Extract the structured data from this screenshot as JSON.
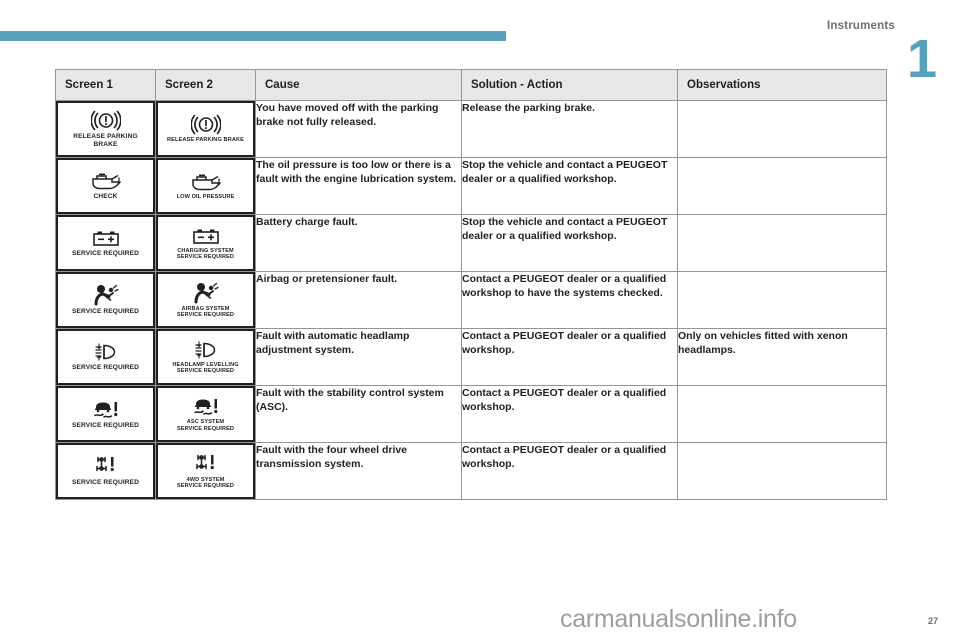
{
  "header": {
    "title": "Instruments",
    "chapter_number": "1",
    "band_color": "#57a0bc"
  },
  "table": {
    "columns": [
      "Screen 1",
      "Screen 2",
      "Cause",
      "Solution - Action",
      "Observations"
    ],
    "rows": [
      {
        "screen1": {
          "icon": "parking-brake-icon",
          "label": "RELEASE PARKING\nBRAKE"
        },
        "screen2": {
          "icon": "parking-brake-icon",
          "label": "RELEASE PARKING BRAKE"
        },
        "cause": "You have moved off with the parking brake not fully released.",
        "solution": "Release the parking brake.",
        "observations": ""
      },
      {
        "screen1": {
          "icon": "oil-can-icon",
          "label": "CHECK"
        },
        "screen2": {
          "icon": "oil-can-icon",
          "label": "LOW OIL PRESSURE"
        },
        "cause": "The oil pressure is too low or there is a fault with the engine lubrication system.",
        "solution": "Stop the vehicle and contact a PEUGEOT dealer or a qualified workshop.",
        "observations": ""
      },
      {
        "screen1": {
          "icon": "battery-icon",
          "label": "SERVICE REQUIRED"
        },
        "screen2": {
          "icon": "battery-icon",
          "label": "CHARGING SYSTEM\nSERVICE REQUIRED"
        },
        "cause": "Battery charge fault.",
        "solution": "Stop the vehicle and contact a PEUGEOT dealer or a qualified workshop.",
        "observations": ""
      },
      {
        "screen1": {
          "icon": "airbag-icon",
          "label": "SERVICE REQUIRED"
        },
        "screen2": {
          "icon": "airbag-icon",
          "label": "AIRBAG SYSTEM\nSERVICE REQUIRED"
        },
        "cause": "Airbag or pretensioner fault.",
        "solution": "Contact a PEUGEOT dealer or a qualified workshop to have the systems checked.",
        "observations": ""
      },
      {
        "screen1": {
          "icon": "headlamp-levelling-icon",
          "label": "SERVICE REQUIRED"
        },
        "screen2": {
          "icon": "headlamp-levelling-icon",
          "label": "HEADLAMP LEVELLING\nSERVICE REQUIRED"
        },
        "cause": "Fault with automatic headlamp adjustment system.",
        "solution": "Contact a PEUGEOT dealer or a qualified workshop.",
        "observations": "Only on vehicles fitted with xenon headlamps."
      },
      {
        "screen1": {
          "icon": "stability-control-icon",
          "label": "SERVICE REQUIRED"
        },
        "screen2": {
          "icon": "stability-control-icon",
          "label": "ASC SYSTEM\nSERVICE REQUIRED"
        },
        "cause": "Fault with the stability control system (ASC).",
        "solution": "Contact a PEUGEOT dealer or a qualified workshop.",
        "observations": ""
      },
      {
        "screen1": {
          "icon": "four-wheel-drive-icon",
          "label": "SERVICE REQUIRED"
        },
        "screen2": {
          "icon": "four-wheel-drive-icon",
          "label": "4WD SYSTEM\nSERVICE REQUIRED"
        },
        "cause": "Fault with the four wheel drive transmission system.",
        "solution": "Contact a PEUGEOT dealer or a qualified workshop.",
        "observations": ""
      }
    ]
  },
  "footer": {
    "watermark": "carmanualsonline.info",
    "page_number": "27"
  }
}
